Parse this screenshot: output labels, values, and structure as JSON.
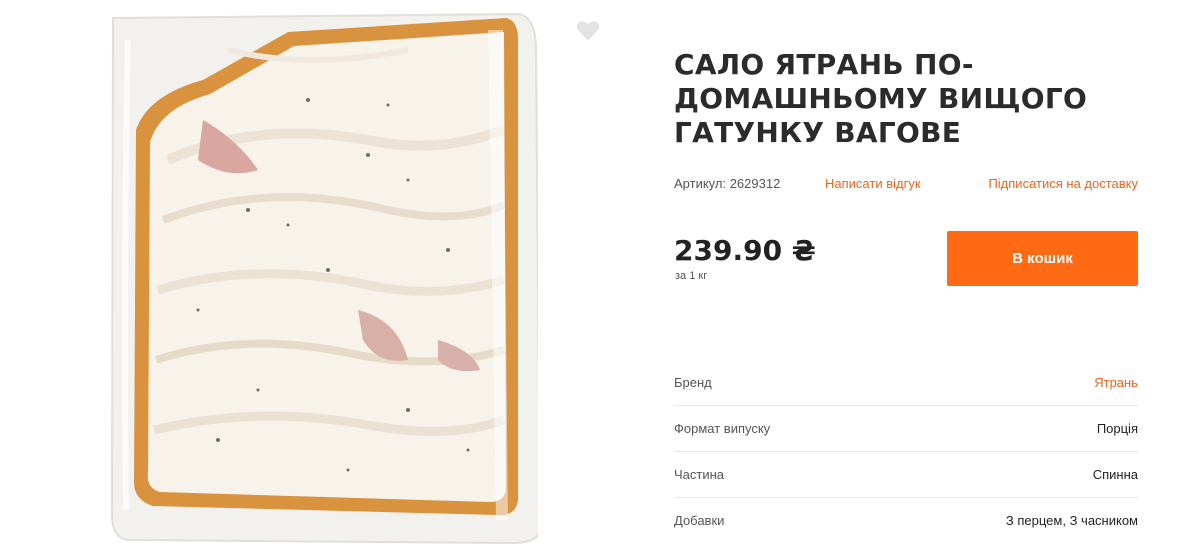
{
  "product": {
    "title": "САЛО ЯТРАНЬ ПО-ДОМАШНЬОМУ ВИЩОГО ГАТУНКУ ВАГОВЕ",
    "sku_text": "Артикул: 2629312",
    "review_link": "Написати відгук",
    "subscribe_link": "Підписатися на доставку",
    "price": "239.90 ₴",
    "unit": "за 1 кг",
    "cart_button": "В кошик",
    "favorite_icon": "heart-icon"
  },
  "specs": [
    {
      "label": "Бренд",
      "value": "Ятрань"
    },
    {
      "label": "Формат випуску",
      "value": "Порція"
    },
    {
      "label": "Частина",
      "value": "Спинна"
    },
    {
      "label": "Добавки",
      "value": "З перцем, З часником"
    }
  ],
  "colors": {
    "accent": "#ff6a13",
    "link": "#e8661f"
  }
}
